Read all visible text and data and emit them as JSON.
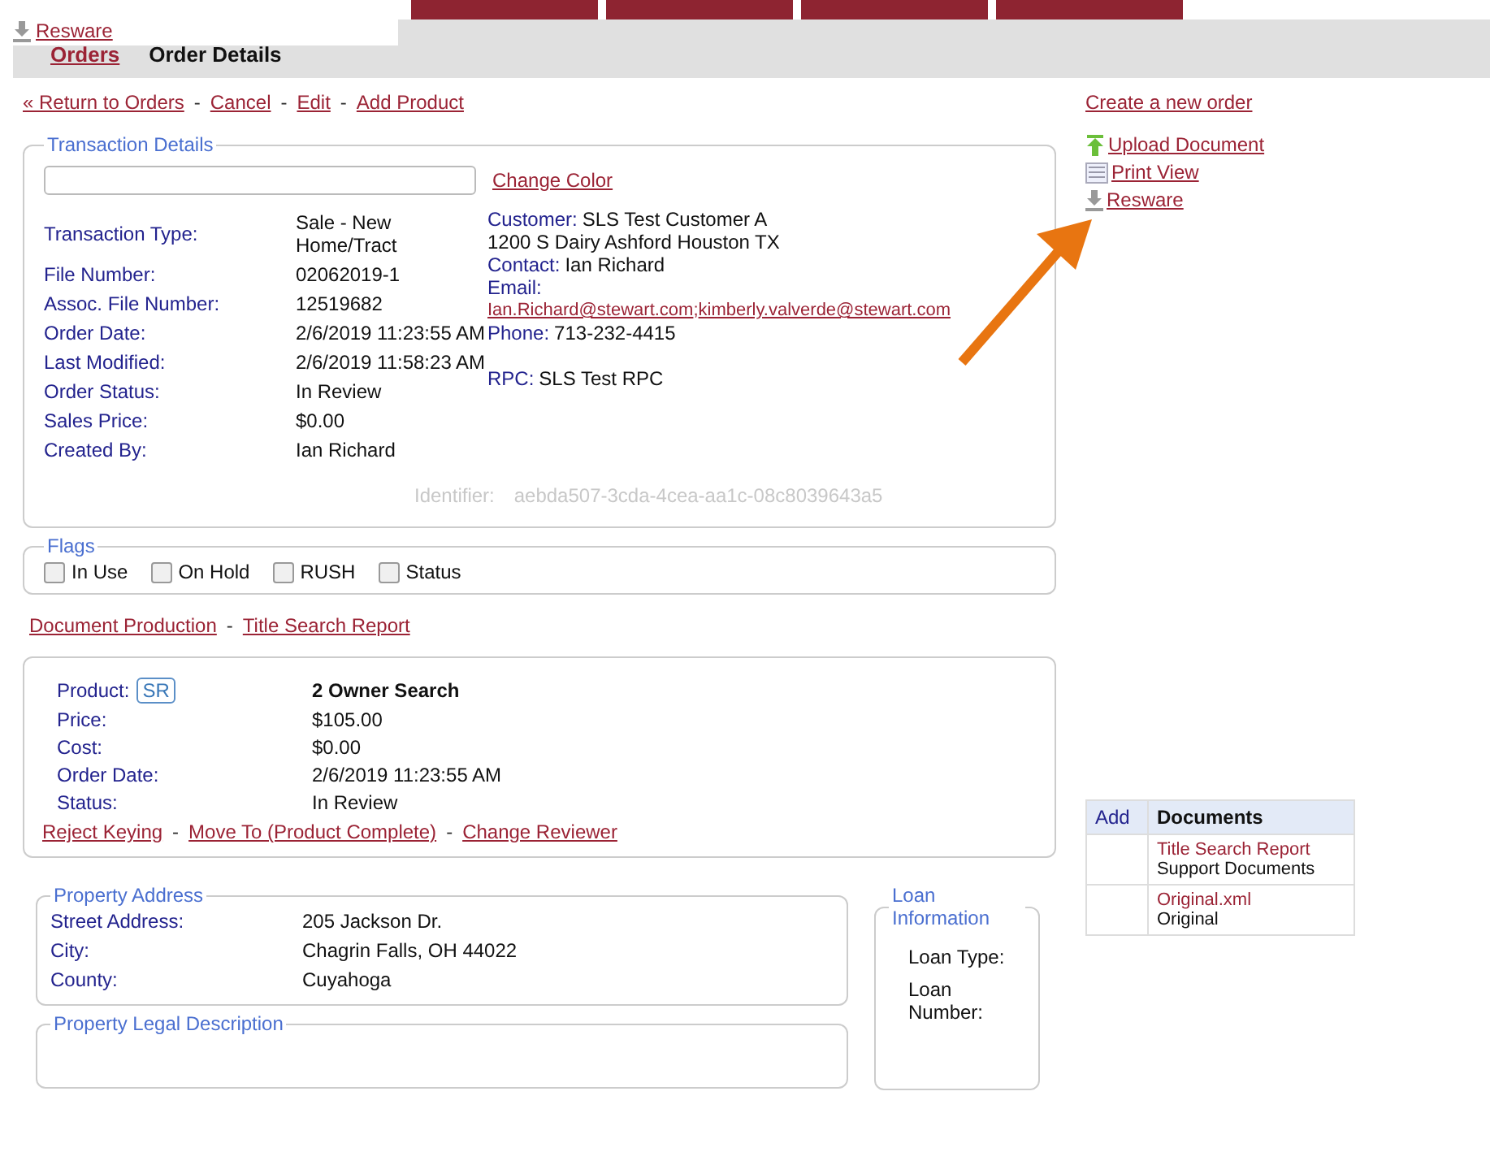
{
  "overlay_menu": {
    "link": "Resware"
  },
  "breadcrumb": {
    "link": "Orders",
    "current": "Order Details"
  },
  "actions": {
    "separator": "-",
    "links": [
      "« Return to Orders",
      "Cancel",
      "Edit",
      "Add Product"
    ]
  },
  "transaction": {
    "legend": "Transaction Details",
    "color_link": "Change Color",
    "fields": [
      {
        "label": "Transaction Type:",
        "value": "Sale - New Home/Tract"
      },
      {
        "label": "File Number:",
        "value": "02062019-1"
      },
      {
        "label": "Assoc. File Number:",
        "value": "12519682"
      },
      {
        "label": "Order Date:",
        "value": "2/6/2019 11:23:55 AM"
      },
      {
        "label": "Last Modified:",
        "value": "2/6/2019 11:58:23 AM"
      },
      {
        "label": "Order Status:",
        "value": "In Review"
      },
      {
        "label": "Sales Price:",
        "value": "$0.00"
      },
      {
        "label": "Created By:",
        "value": "Ian Richard"
      }
    ],
    "customer": {
      "label": "Customer:",
      "value": "SLS Test Customer A"
    },
    "address": "1200 S Dairy Ashford Houston  TX",
    "contact": {
      "label": "Contact:",
      "value": "Ian Richard"
    },
    "email": {
      "label": "Email:",
      "links": [
        "Ian.Richard@stewart.com",
        "kimberly.valverde@stewart.com"
      ],
      "separator": ";"
    },
    "phone": {
      "label": "Phone:",
      "value": "713-232-4415"
    },
    "rpc": {
      "label": "RPC:",
      "value": "SLS Test RPC"
    },
    "identifier": {
      "label": "Identifier:",
      "value": "aebda507-3cda-4cea-aa1c-08c8039643a5"
    }
  },
  "flags": {
    "legend": "Flags",
    "items": [
      {
        "label": "In Use",
        "checked": false
      },
      {
        "label": "On Hold",
        "checked": false
      },
      {
        "label": "RUSH",
        "checked": false
      },
      {
        "label": "Status",
        "checked": false
      }
    ]
  },
  "doc_links": {
    "separator": "-",
    "links": [
      "Document Production",
      "Title Search Report"
    ]
  },
  "product": {
    "fields": [
      {
        "label": "Product:",
        "badge": "SR",
        "value": "2 Owner Search"
      },
      {
        "label": "Price:",
        "value": "$105.00"
      },
      {
        "label": "Cost:",
        "value": "$0.00"
      },
      {
        "label": "Order Date:",
        "value": "2/6/2019 11:23:55 AM"
      },
      {
        "label": "Status:",
        "value": "In Review"
      }
    ],
    "separator": "-",
    "actions": [
      "Reject Keying",
      "Move To (Product Complete)",
      "Change Reviewer"
    ]
  },
  "property": {
    "legend": "Property Address",
    "fields": [
      {
        "label": "Street Address:",
        "value": "205 Jackson Dr."
      },
      {
        "label": "City:",
        "value": "Chagrin Falls, OH 44022"
      },
      {
        "label": "County:",
        "value": "Cuyahoga"
      }
    ]
  },
  "legal": {
    "legend": "Property Legal Description"
  },
  "loan": {
    "legend": "Loan Information",
    "fields": [
      "Loan Type:",
      "Loan Number:"
    ]
  },
  "sidebar": {
    "create_link": "Create a new order",
    "tools": [
      {
        "kind": "upload",
        "label": "Upload Document"
      },
      {
        "kind": "print",
        "label": "Print View"
      },
      {
        "kind": "download",
        "label": "Resware"
      }
    ]
  },
  "documents": {
    "columns": [
      "Add",
      "Documents"
    ],
    "rows": [
      {
        "link": "Title Search Report",
        "type": "Support Documents"
      },
      {
        "link": "Original.xml",
        "type": "Original"
      }
    ]
  }
}
